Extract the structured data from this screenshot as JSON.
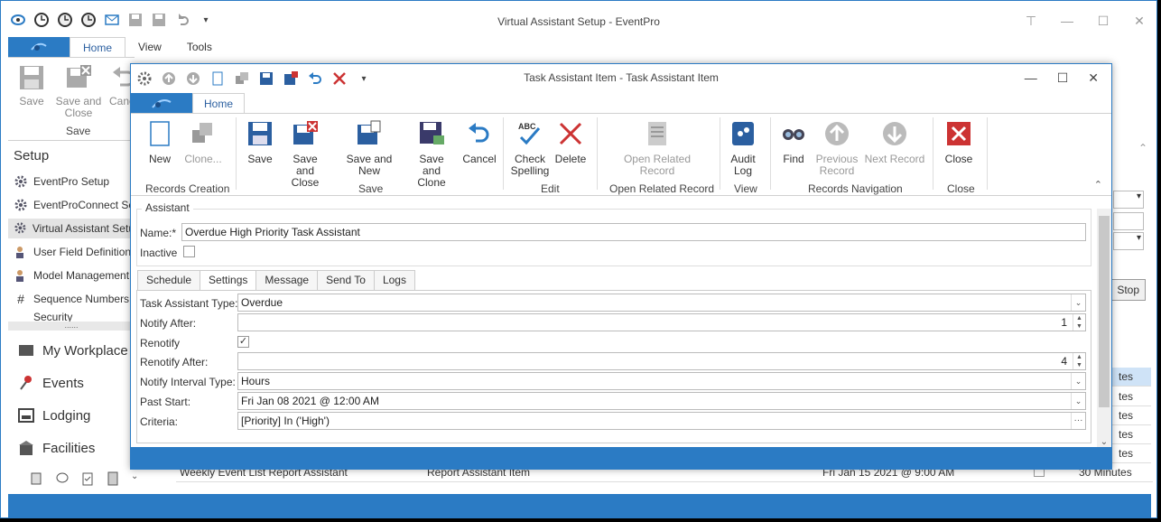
{
  "main": {
    "title": "Virtual Assistant Setup - EventPro",
    "tabs": [
      "Home",
      "View",
      "Tools"
    ],
    "ribbon": {
      "save": "Save",
      "save_close": "Save and Close",
      "cancel": "Canc",
      "group_save": "Save"
    },
    "nav": {
      "title": "Setup",
      "items": [
        "EventPro Setup",
        "EventProConnect Setu",
        "Virtual Assistant Setu",
        "User Field Definition",
        "Model Management",
        "Sequence Numbers",
        "Security"
      ],
      "big": [
        "My Workplace",
        "Events",
        "Lodging",
        "Facilities"
      ],
      "splitter": "......"
    },
    "grid_row": {
      "name": "Weekly Event List Report Assistant",
      "type": "Report Assistant Item",
      "start": "Fri Jan 15 2021 @ 9:00 AM",
      "interval": "30 Minutes"
    },
    "right_peek": {
      "stop": "Stop",
      "rows": [
        "tes",
        "tes",
        "tes",
        "tes",
        "tes"
      ]
    }
  },
  "dialog": {
    "title": "Task Assistant Item - Task Assistant Item",
    "tab": "Home",
    "buttons": {
      "new": "New",
      "clone": "Clone...",
      "save": "Save",
      "save_close": "Save and Close",
      "save_new": "Save and New",
      "save_clone": "Save and Clone",
      "cancel": "Cancel",
      "check_spelling": "Check Spelling",
      "delete": "Delete",
      "open_related": "Open Related Record",
      "audit_log": "Audit Log",
      "find": "Find",
      "previous": "Previous Record",
      "next": "Next Record",
      "close": "Close"
    },
    "groups": {
      "records_creation": "Records Creation",
      "save": "Save",
      "edit": "Edit",
      "open_related": "Open Related Record",
      "view": "View",
      "records_navigation": "Records Navigation",
      "close": "Close"
    },
    "assistant": {
      "section": "Assistant",
      "name_label": "Name:*",
      "name_value": "Overdue High Priority Task Assistant",
      "inactive_label": "Inactive"
    },
    "tabs": [
      "Schedule",
      "Settings",
      "Message",
      "Send To",
      "Logs"
    ],
    "settings": {
      "type_label": "Task Assistant Type:",
      "type_value": "Overdue",
      "notify_after_label": "Notify After:",
      "notify_after_value": "1",
      "renotify_label": "Renotify",
      "renotify_after_label": "Renotify After:",
      "renotify_after_value": "4",
      "interval_type_label": "Notify Interval Type:",
      "interval_type_value": "Hours",
      "past_start_label": "Past Start:",
      "past_start_value": "Fri Jan 08 2021 @ 12:00 AM",
      "criteria_label": "Criteria:",
      "criteria_value": "[Priority] In ('High')"
    }
  }
}
